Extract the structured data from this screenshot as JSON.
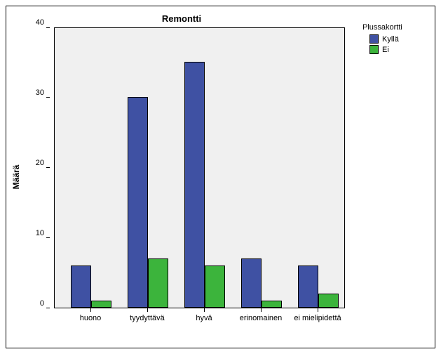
{
  "chart_data": {
    "type": "bar",
    "title": "Remontti",
    "ylabel": "Määrä",
    "xlabel": "",
    "ylim": [
      0,
      40
    ],
    "yticks": [
      0,
      10,
      20,
      30,
      40
    ],
    "categories": [
      "huono",
      "tyydyttävä",
      "hyvä",
      "erinomainen",
      "ei mielipidettä"
    ],
    "series": [
      {
        "name": "Kyllä",
        "values": [
          6,
          30,
          35,
          7,
          6
        ],
        "color": "#3f51a3"
      },
      {
        "name": "Ei",
        "values": [
          1,
          7,
          6,
          1,
          2
        ],
        "color": "#3cb43c"
      }
    ],
    "legend_title": "Plussakortti"
  }
}
